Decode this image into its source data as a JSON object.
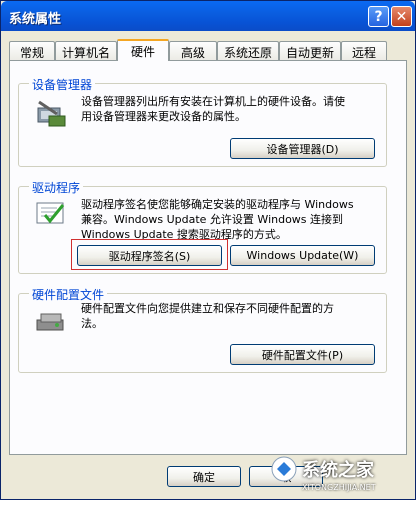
{
  "window": {
    "title": "系统属性"
  },
  "tabs": [
    "常规",
    "计算机名",
    "硬件",
    "高级",
    "系统还原",
    "自动更新",
    "远程"
  ],
  "device_manager": {
    "label": "设备管理器",
    "description_line1": "设备管理器列出所有安装在计算机上的硬件设备。请使",
    "description_line2": "用设备管理器来更改设备的属性。",
    "button": "设备管理器(D)"
  },
  "drivers": {
    "label": "驱动程序",
    "description_line1": "驱动程序签名使您能够确定安装的驱动程序与 Windows",
    "description_line2": "兼容。Windows Update 允许设置 Windows 连接到",
    "description_line3": "Windows Update 搜索驱动程序的方式。",
    "signing_button": "驱动程序签名(S)",
    "update_button": "Windows Update(W)"
  },
  "hardware_profiles": {
    "label": "硬件配置文件",
    "description_line1": "硬件配置文件向您提供建立和保存不同硬件配置的方",
    "description_line2": "法。",
    "button": "硬件配置文件(P)"
  },
  "footer": {
    "ok": "确定",
    "cancel": "取"
  },
  "watermark": {
    "text": "系统之家",
    "sub": "XITONGZHIJIA.NET"
  }
}
